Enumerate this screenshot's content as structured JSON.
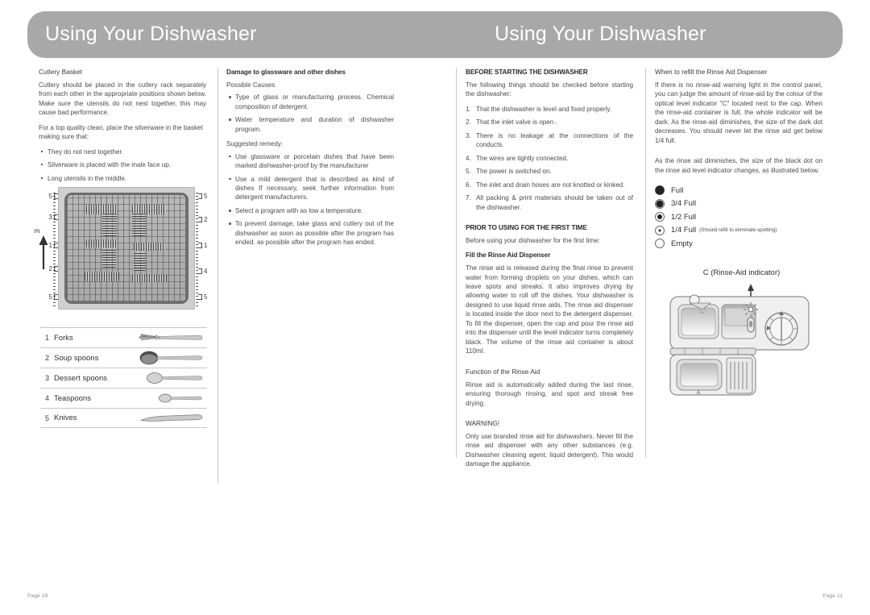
{
  "left_page": {
    "header_title": "Using Your Dishwasher",
    "footer": "Page 18",
    "col1": {
      "heading": "Cutlery Basket",
      "para1": "Cutlery should be placed in the cutlery rack separately from each other  in the appropriate positions shown below. Make sure the utensils do not nest together, this may cause bad performance.",
      "para2": "For a  top quality clean, place the silverware in the basket making sure that:",
      "bullets": [
        "They do not nest together.",
        "Silverware is placed  with the male face up.",
        "Long utensils in the middle."
      ],
      "figure": {
        "in_label": "IN",
        "left_ticks": [
          "5",
          "3",
          "1",
          "2",
          "5"
        ],
        "right_ticks": [
          "5",
          "2",
          "1",
          "4",
          "5"
        ]
      },
      "legend": [
        {
          "num": "1",
          "name": "Forks",
          "icon": "fork-icon"
        },
        {
          "num": "2",
          "name": "Soup spoons",
          "icon": "soup-spoon-icon"
        },
        {
          "num": "3",
          "name": "Dessert spoons",
          "icon": "dessert-spoon-icon"
        },
        {
          "num": "4",
          "name": "Teaspoons",
          "icon": "teaspoon-icon"
        },
        {
          "num": "5",
          "name": "Knives",
          "icon": "knife-icon"
        }
      ]
    },
    "col2": {
      "heading": "Damage to glassware and other dishes",
      "subheading1": "Possible Causes",
      "causes": [
        "Type of glass or manufacturing process. Chemical composition of detergent.",
        "Water temperature and duration of dishwasher program."
      ],
      "subheading2": "Suggested remedy:",
      "remedies": [
        "Use glassware or porcelain dishes that have been marked dishwasher-proof by the manufacturer",
        "Use a mild detergent that is described as kind of dishes If necessary, seek further information from detergent manufacturers.",
        "Select a program with as low a temperature.",
        "To prevent damage, take glass and cutlery out of the dishwasher as soon as possible after the program has ended. as possible after the program has ended."
      ]
    }
  },
  "right_page": {
    "header_title": "Using Your Dishwasher",
    "footer": "Page 11",
    "col3": {
      "heading1": "BEFORE STARTING THE DISHWASHER",
      "intro": "The following things should be checked before starting the dishwasher:",
      "checklist": [
        "That the dishwasher is level and fixed properly.",
        "That the inlet valve is open .",
        "There is no leakage at the connections of the conducts.",
        "The wires are tightly connected.",
        "The power is switched on.",
        "The inlet and drain hoses are not knotted or kinked.",
        "All packing & print materials should be taken out of the dishwasher."
      ],
      "heading2": "PRIOR TO USING FOR THE FIRST TIME",
      "intro2": "Before using your dishwasher for the first time:",
      "heading3": "Fill the Rinse Aid Dispenser",
      "para3": "The rinse aid is released during the final rinse to prevent water from forming droplets on your dishes, which can leave spots and streaks. It also improves drying by allowing water to roll off the dishes. Your dishwasher is designed to use liquid rinse aids. The rinse aid dispenser is located inside the door next to the detergent dispenser. To fill the dispenser, open the cap and pour the rinse aid into the dispenser until the level indicator turns completely black. The volume of the rinse aid container is about 110ml.",
      "heading4": "Function of the Rinse Aid",
      "para4": "Rinse aid is automatically added during the last rinse, ensuring thorough rinsing, and spot and streak free drying.",
      "heading5": "WARNING!",
      "para5": "Only use branded rinse aid for dishwashers. Never fill the rinse aid dispenser with any other substances (e.g. Dishwasher cleaning agent, liquid detergent). This would damage the appliance."
    },
    "col4": {
      "heading": "When to refill the Rinse Aid Dispenser",
      "para1": "If there is no rinse-aid warning light in the control panel, you can judge the amount of rinse-aid by the colour of the optical level indicator  \"C\"  located next to the cap. When the rinse-aid container is full, the whole indicator will be dark. As the rinse-aid diminishes, the size of the dark dot decreases. You should never let the rinse aid get below 1/4 full.",
      "para2": "As the rinse aid diminishes, the size of the black dot on the rinse aid level indicator changes, as illustrated below.",
      "indicator_levels": [
        {
          "label": "Full",
          "dot_size": 11,
          "note": ""
        },
        {
          "label": "3/4 Full",
          "dot_size": 9,
          "note": ""
        },
        {
          "label": "1/2 Full",
          "dot_size": 6,
          "note": ""
        },
        {
          "label": "1/4 Full",
          "dot_size": 3,
          "note": "(Should refill to eliminate spotting)"
        },
        {
          "label": "Empty",
          "dot_size": 0,
          "note": ""
        }
      ],
      "figure_caption": "C (Rinse-Aid indicator)",
      "diagram_labels": {
        "rinse_aid_marker": "C"
      }
    }
  },
  "colors": {
    "banner": "#a8a8a8",
    "banner_text": "#ffffff",
    "body_text": "#4a4a4a",
    "rule": "#c5c5c5",
    "footer_text": "#8e8e8e"
  }
}
